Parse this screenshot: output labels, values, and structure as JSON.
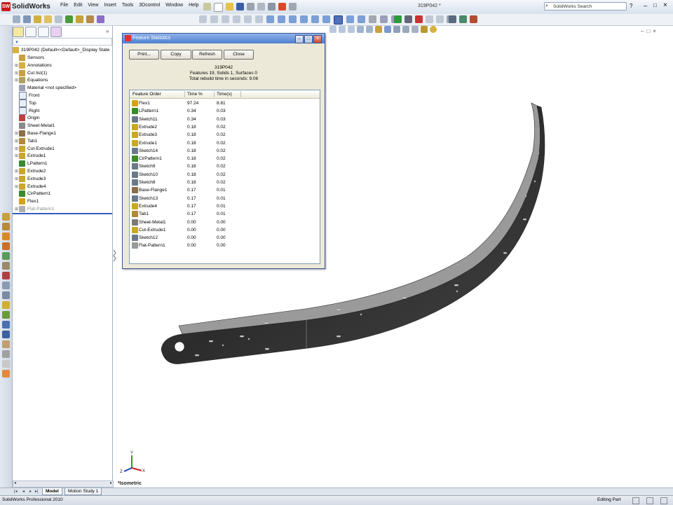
{
  "app": {
    "name": "SolidWorks",
    "logo_badge": "SW",
    "document_title": "319P042 *",
    "menu": [
      "File",
      "Edit",
      "View",
      "Insert",
      "Tools",
      "3Dcontrol",
      "Window",
      "Help"
    ],
    "search_placeholder": "SolidWorks Search",
    "help_icon": "?",
    "window_controls": [
      "–",
      "□",
      "×"
    ]
  },
  "feature_tree": {
    "root": "319P042  (Default<<Default>_Display State",
    "items": [
      {
        "label": "Sensors",
        "icon": "sensor-icon",
        "expandable": false
      },
      {
        "label": "Annotations",
        "icon": "annotations-icon",
        "expandable": true
      },
      {
        "label": "Cut list(1)",
        "icon": "cut-list-icon",
        "expandable": true
      },
      {
        "label": "Equations",
        "icon": "equations-icon",
        "expandable": true
      },
      {
        "label": "Material <not specified>",
        "icon": "material-icon",
        "expandable": false
      },
      {
        "label": "Front",
        "icon": "plane-icon",
        "expandable": false
      },
      {
        "label": "Top",
        "icon": "plane-icon",
        "expandable": false
      },
      {
        "label": "Right",
        "icon": "plane-icon",
        "expandable": false
      },
      {
        "label": "Origin",
        "icon": "origin-icon",
        "expandable": false
      },
      {
        "label": "Sheet-Metal1",
        "icon": "sheet-metal-icon",
        "expandable": false
      },
      {
        "label": "Base-Flange1",
        "icon": "base-flange-icon",
        "expandable": true
      },
      {
        "label": "Tab1",
        "icon": "tab-icon",
        "expandable": true
      },
      {
        "label": "Cut-Extrude1",
        "icon": "cut-extrude-icon",
        "expandable": true
      },
      {
        "label": "Extrude1",
        "icon": "extrude-icon",
        "expandable": true
      },
      {
        "label": "LPattern1",
        "icon": "linear-pattern-icon",
        "expandable": false
      },
      {
        "label": "Extrude2",
        "icon": "extrude-icon",
        "expandable": true
      },
      {
        "label": "Extrude3",
        "icon": "extrude-icon",
        "expandable": true
      },
      {
        "label": "Extrude4",
        "icon": "extrude-icon",
        "expandable": true
      },
      {
        "label": "CirPattern1",
        "icon": "circular-pattern-icon",
        "expandable": false
      },
      {
        "label": "Flex1",
        "icon": "flex-icon",
        "expandable": false
      },
      {
        "label": "Flat-Pattern1",
        "icon": "flat-pattern-icon",
        "expandable": true,
        "suppressed": true
      }
    ]
  },
  "dialog": {
    "title": "Feature Statistics",
    "buttons": {
      "print": "Print...",
      "copy": "Copy",
      "refresh": "Refresh",
      "close": "Close"
    },
    "part_name": "319P042",
    "summary": "Features 19, Solids 1, Surfaces 0",
    "rebuild_time": "Total rebuild time in seconds: 9.06",
    "columns": [
      "Feature Order",
      "Time %",
      "Time(s)"
    ],
    "rows": [
      {
        "name": "Flex1",
        "pct": "97.24",
        "sec": "8.81",
        "color": "#d6a21e"
      },
      {
        "name": "LPattern1",
        "pct": "0.34",
        "sec": "0.03",
        "color": "#3a8a2e"
      },
      {
        "name": "Sketch11",
        "pct": "0.34",
        "sec": "0.03",
        "color": "#6a7a8a"
      },
      {
        "name": "Extrude2",
        "pct": "0.18",
        "sec": "0.02",
        "color": "#c9a826"
      },
      {
        "name": "Extrude3",
        "pct": "0.18",
        "sec": "0.02",
        "color": "#c9a826"
      },
      {
        "name": "Extrude1",
        "pct": "0.18",
        "sec": "0.02",
        "color": "#c9a826"
      },
      {
        "name": "Sketch14",
        "pct": "0.18",
        "sec": "0.02",
        "color": "#6a7a8a"
      },
      {
        "name": "CirPattern1",
        "pct": "0.18",
        "sec": "0.02",
        "color": "#3a8a2e"
      },
      {
        "name": "Sketch9",
        "pct": "0.18",
        "sec": "0.02",
        "color": "#6a7a8a"
      },
      {
        "name": "Sketch10",
        "pct": "0.18",
        "sec": "0.02",
        "color": "#6a7a8a"
      },
      {
        "name": "Sketch8",
        "pct": "0.18",
        "sec": "0.02",
        "color": "#6a7a8a"
      },
      {
        "name": "Base-Flange1",
        "pct": "0.17",
        "sec": "0.01",
        "color": "#8a6e4a"
      },
      {
        "name": "Sketch13",
        "pct": "0.17",
        "sec": "0.01",
        "color": "#6a7a8a"
      },
      {
        "name": "Extrude4",
        "pct": "0.17",
        "sec": "0.01",
        "color": "#c9a826"
      },
      {
        "name": "Tab1",
        "pct": "0.17",
        "sec": "0.01",
        "color": "#b08a3a"
      },
      {
        "name": "Sheet-Metal1",
        "pct": "0.00",
        "sec": "0.00",
        "color": "#7a7a7a"
      },
      {
        "name": "Cut-Extrude1",
        "pct": "0.00",
        "sec": "0.00",
        "color": "#c9a826"
      },
      {
        "name": "Sketch12",
        "pct": "0.00",
        "sec": "0.00",
        "color": "#6a7a8a"
      },
      {
        "name": "Flat-Pattern1",
        "pct": "0.00",
        "sec": "0.00",
        "color": "#9a9a9a"
      }
    ]
  },
  "graphics": {
    "view_label": "*Isometric",
    "triad_labels": {
      "x": "X",
      "y": "Y",
      "z": "Z"
    }
  },
  "bottom_tabs": [
    "Model",
    "Motion Study 1"
  ],
  "status": {
    "left": "SolidWorks Professional 2010",
    "right": "Editing Part"
  }
}
